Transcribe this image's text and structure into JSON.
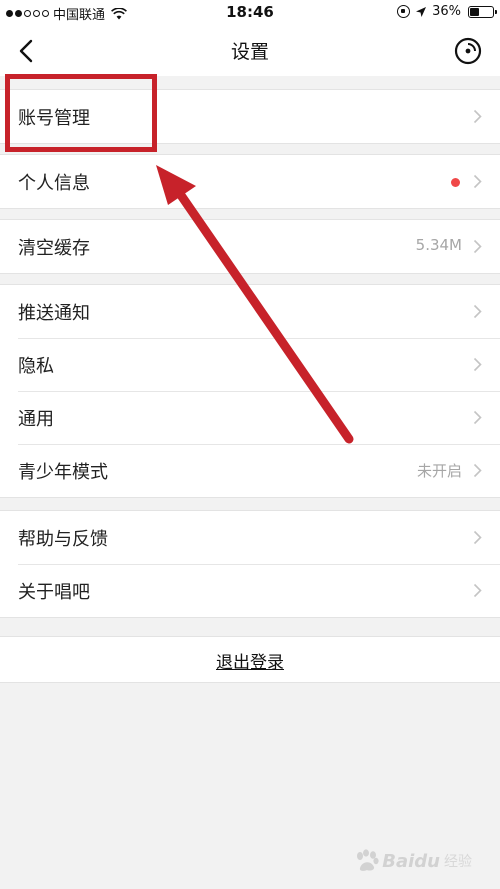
{
  "status_bar": {
    "carrier": "中国联通",
    "time": "18:46",
    "battery": "36%"
  },
  "nav": {
    "title": "设置"
  },
  "groups": [
    {
      "items": [
        {
          "label": "账号管理"
        }
      ]
    },
    {
      "items": [
        {
          "label": "个人信息",
          "has_badge": true
        }
      ]
    },
    {
      "items": [
        {
          "label": "清空缓存",
          "value": "5.34M"
        }
      ]
    },
    {
      "items": [
        {
          "label": "推送通知"
        },
        {
          "label": "隐私"
        },
        {
          "label": "通用"
        },
        {
          "label": "青少年模式",
          "value": "未开启"
        }
      ]
    },
    {
      "items": [
        {
          "label": "帮助与反馈"
        },
        {
          "label": "关于唱吧"
        }
      ]
    }
  ],
  "logout": {
    "label": "退出登录"
  },
  "watermark": {
    "brand": "Baidu",
    "sub": "经验"
  },
  "colors": {
    "annotation": "#c7222a",
    "badge": "#f04848"
  }
}
